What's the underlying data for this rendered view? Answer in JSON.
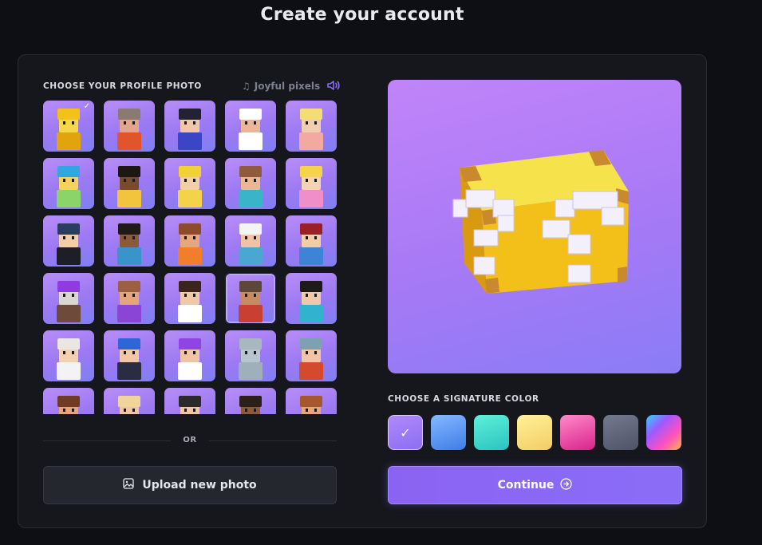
{
  "page_title": "Create your account",
  "profile": {
    "label": "CHOOSE YOUR PROFILE PHOTO",
    "music_label": "Joyful pixels",
    "avatars": [
      {
        "name": "avatar-lucky-block",
        "hair": "#f2c21a",
        "skin": "#f6d64a",
        "shirt": "#e1a40c",
        "selected": true
      },
      {
        "name": "avatar-bald-glasses",
        "hair": "#8b7a72",
        "skin": "#e2a58c",
        "shirt": "#e0552a"
      },
      {
        "name": "avatar-dark-hair-blue",
        "hair": "#222232",
        "skin": "#f0c7a8",
        "shirt": "#3a46c6"
      },
      {
        "name": "avatar-chef",
        "hair": "#ffffff",
        "skin": "#ebb79b",
        "shirt": "#ffffff"
      },
      {
        "name": "avatar-blonde-bun",
        "hair": "#f5dd75",
        "skin": "#f0cfb0",
        "shirt": "#f4a9a0"
      },
      {
        "name": "avatar-blue-hair",
        "hair": "#31a6e3",
        "skin": "#f4d25c",
        "shirt": "#8ad46a"
      },
      {
        "name": "avatar-curly-dark",
        "hair": "#1d1714",
        "skin": "#7a4a2e",
        "shirt": "#f2c33c"
      },
      {
        "name": "avatar-blonde-yellow",
        "hair": "#f2d132",
        "skin": "#f1cfa9",
        "shirt": "#f4d24a"
      },
      {
        "name": "avatar-goggles",
        "hair": "#8f5b3e",
        "skin": "#ebb692",
        "shirt": "#39b4c8"
      },
      {
        "name": "avatar-princess",
        "hair": "#f6d44a",
        "skin": "#f4d2b4",
        "shirt": "#f08ec9"
      },
      {
        "name": "avatar-wizard-hat",
        "hair": "#2b3c63",
        "skin": "#f3ccaa",
        "shirt": "#1e1e26"
      },
      {
        "name": "avatar-short-dark",
        "hair": "#1f1a18",
        "skin": "#8c5a3a",
        "shirt": "#3a93c9"
      },
      {
        "name": "avatar-brown-bob",
        "hair": "#8d4b2c",
        "skin": "#e7a67d",
        "shirt": "#f07e2b"
      },
      {
        "name": "avatar-white-cap",
        "hair": "#f4f4f4",
        "skin": "#f0c3a4",
        "shirt": "#49a7d2"
      },
      {
        "name": "avatar-red-cap",
        "hair": "#9a1f27",
        "skin": "#f2cda8",
        "shirt": "#3d83d6"
      },
      {
        "name": "avatar-purple-mohawk",
        "hair": "#8e3ce0",
        "skin": "#d8d8d0",
        "shirt": "#6d4a3a"
      },
      {
        "name": "avatar-bearded",
        "hair": "#9c6040",
        "skin": "#e4a57d",
        "shirt": "#8a44d6"
      },
      {
        "name": "avatar-buns",
        "hair": "#3b241b",
        "skin": "#f0c8a8",
        "shirt": "#ffffff"
      },
      {
        "name": "avatar-hover-bearded",
        "hair": "#5d4738",
        "skin": "#c98a62",
        "shirt": "#c94032"
      },
      {
        "name": "avatar-dark-teal",
        "hair": "#1f1a1a",
        "skin": "#f0c9ac",
        "shirt": "#31b3cf"
      },
      {
        "name": "avatar-astronaut",
        "hair": "#e9e6e3",
        "skin": "#f2d0b0",
        "shirt": "#f3f3f3"
      },
      {
        "name": "avatar-blue-wizard",
        "hair": "#2e66d8",
        "skin": "#f1c7a6",
        "shirt": "#2a2d42"
      },
      {
        "name": "avatar-purple-ponytail",
        "hair": "#8e45e2",
        "skin": "#f0c4a4",
        "shirt": "#ffffff"
      },
      {
        "name": "avatar-robot",
        "hair": "#a9b7c0",
        "skin": "#b7c6ce",
        "shirt": "#9fb0ba"
      },
      {
        "name": "avatar-knight",
        "hair": "#7ea0b3",
        "skin": "#f0c4a4",
        "shirt": "#d44a2c"
      },
      {
        "name": "avatar-partial-1",
        "hair": "#6e3c22",
        "skin": "#e4a57d",
        "shirt": "#b479f2"
      },
      {
        "name": "avatar-straw-hat",
        "hair": "#f0d49a",
        "skin": "#f0c4a4",
        "shirt": "#d6363c"
      },
      {
        "name": "avatar-checkered",
        "hair": "#2a2a2a",
        "skin": "#f0c4a4",
        "shirt": "#ffffff"
      },
      {
        "name": "avatar-partial-2",
        "hair": "#2b1f1a",
        "skin": "#8c5a3a",
        "shirt": "#b479f2"
      },
      {
        "name": "avatar-partial-3",
        "hair": "#a4582c",
        "skin": "#e4a57d",
        "shirt": "#b479f2"
      }
    ]
  },
  "or_text": "OR",
  "upload_label": "Upload new photo",
  "color": {
    "label": "CHOOSE A SIGNATURE COLOR",
    "swatches": [
      {
        "name": "violet",
        "bg": "linear-gradient(160deg,#b088fa,#8c6ff4)",
        "selected": true
      },
      {
        "name": "blue",
        "bg": "linear-gradient(160deg,#86b8ff,#3c7de6)"
      },
      {
        "name": "teal",
        "bg": "linear-gradient(160deg,#5ef0d9,#2ac3c0)"
      },
      {
        "name": "yellow",
        "bg": "linear-gradient(160deg,#fff19a,#f3cd64)"
      },
      {
        "name": "pink",
        "bg": "linear-gradient(160deg,#ff8ac9,#d9238a)"
      },
      {
        "name": "slate",
        "bg": "linear-gradient(160deg,#747a8f,#4e5366)"
      },
      {
        "name": "rainbow",
        "bg": "linear-gradient(135deg,#30d1ff,#9c5bff,#ff4fc0,#ffb347)"
      }
    ]
  },
  "continue_label": "Continue",
  "accent": "#8b6cf6"
}
